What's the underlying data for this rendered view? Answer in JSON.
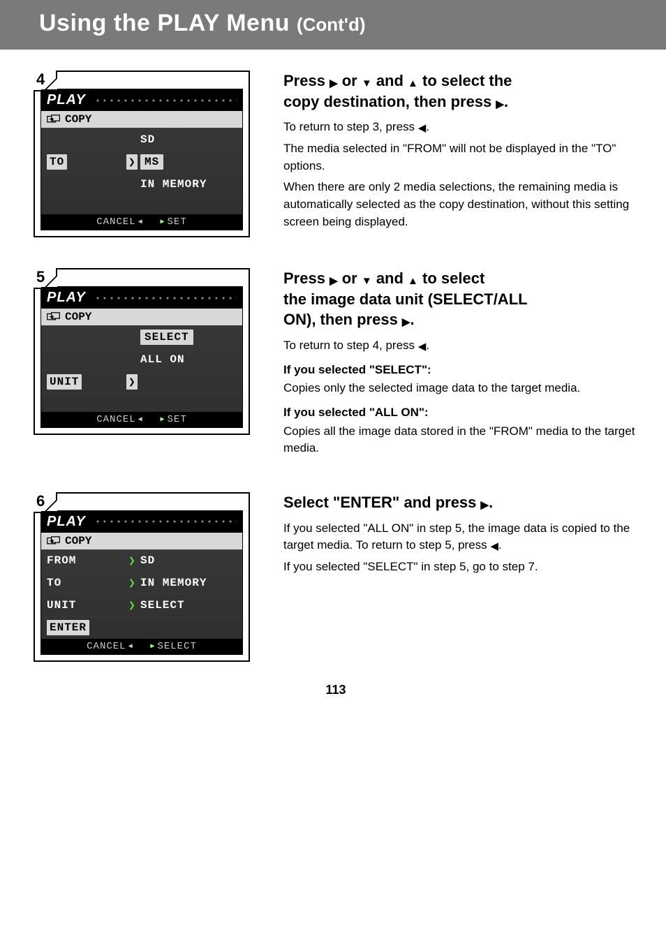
{
  "title": {
    "main": "Using the PLAY Menu ",
    "sub": "(Cont'd)"
  },
  "glyphs": {
    "right": "▶",
    "left": "◀",
    "down": "▼",
    "up": "▲",
    "chev": "❯"
  },
  "lcd_common": {
    "play": "PLAY",
    "copy": "COPY",
    "cancel": "CANCEL",
    "set": "SET",
    "select_footer": "SELECT"
  },
  "step4": {
    "num": "4",
    "rows": {
      "r1_value": "SD",
      "r2_label": "TO",
      "r2_value": "MS",
      "r3_value": "IN MEMORY"
    },
    "head": [
      "Press ",
      " or ",
      " and ",
      " to select the",
      "copy destination, then press ",
      "."
    ],
    "body": [
      "To return to step 3, press ",
      ".",
      "The media selected in \"FROM\" will not be displayed in the \"TO\" options.",
      "When there are only 2 media selections, the remaining media is automatically selected as the copy destination, without this setting screen being displayed."
    ]
  },
  "step5": {
    "num": "5",
    "rows": {
      "r1_value": "SELECT",
      "r2_value": "ALL ON",
      "r3_label": "UNIT"
    },
    "head": [
      "Press ",
      " or ",
      " and ",
      " to select",
      "the image data unit (SELECT/ALL",
      " ON), then press ",
      "."
    ],
    "body": [
      "To return to step 4, press ",
      "."
    ],
    "optA": {
      "title": "If you selected \"SELECT\":",
      "text": "Copies only the selected image data to the target media."
    },
    "optB": {
      "title": "If you selected \"ALL ON\":",
      "text": "Copies all the image data stored in the \"FROM\" media to the target media."
    }
  },
  "step6": {
    "num": "6",
    "rows": {
      "from_l": "FROM",
      "from_v": "SD",
      "to_l": "TO",
      "to_v": "IN MEMORY",
      "unit_l": "UNIT",
      "unit_v": "SELECT",
      "enter": "ENTER"
    },
    "head": [
      "Select \"ENTER\" and press ",
      "."
    ],
    "body": [
      "If you selected \"ALL ON\" in step 5, the image data is copied to the target media. To return to step 5, press ",
      ".",
      "If you selected \"SELECT\" in step 5, go to step 7."
    ]
  },
  "page_number": "113"
}
